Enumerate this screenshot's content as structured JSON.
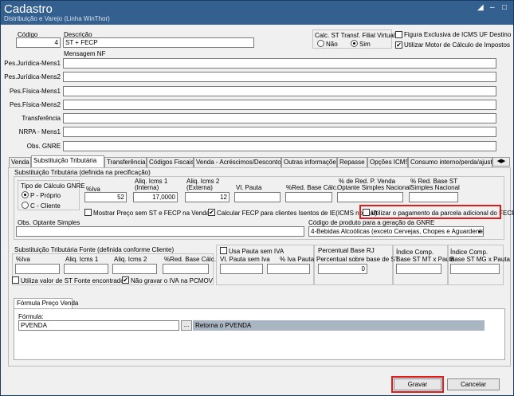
{
  "window": {
    "title": "Cadastro",
    "subtitle": "Distribuição e Varejo (Linha WinThor)"
  },
  "header": {
    "codigo_label": "Código",
    "codigo_value": "4",
    "descricao_label": "Descrição",
    "descricao_value": "ST + FECP",
    "calc_st_label": "Calc. ST Transf. Filial Virtual",
    "nao_label": "Não",
    "sim_label": "Sim",
    "figura_exclusiva_label": "Figura Exclusiva de ICMS UF Destino",
    "utilizar_motor_label": "Utilizar Motor de Cálculo de Impostos",
    "mensagem_nf_label": "Mensagem NF"
  },
  "messages": [
    {
      "label": "Pes.Jurídica-Mens1",
      "value": ""
    },
    {
      "label": "Pes.Jurídica-Mens2",
      "value": ""
    },
    {
      "label": "Pes.Física-Mens1",
      "value": ""
    },
    {
      "label": "Pes.Física-Mens2",
      "value": ""
    },
    {
      "label": "Transferência",
      "value": ""
    },
    {
      "label": "NRPA - Mens1",
      "value": ""
    },
    {
      "label": "Obs. GNRE",
      "value": ""
    }
  ],
  "tabs": [
    {
      "label": "Venda"
    },
    {
      "label": "Substituição Tributária"
    },
    {
      "label": "Transferência"
    },
    {
      "label": "Códigos Fiscais"
    },
    {
      "label": "Venda - Acréscimos/Descontos"
    },
    {
      "label": "Outras informações"
    },
    {
      "label": "Repasse"
    },
    {
      "label": "Opções ICMS"
    },
    {
      "label": "Consumo interno/perda/ajuste"
    }
  ],
  "st": {
    "group_title": "Substituição Tributária (definida na precificação)",
    "tipo_calculo_label": "Tipo de Cálculo GNRE",
    "p_proprio": "P - Próprio",
    "c_cliente": "C - Cliente",
    "iva_label": "%Iva",
    "iva_value": "52",
    "aliq1_label1": "Aliq. Icms 1",
    "aliq1_label2": "(Interna)",
    "aliq1_value": "17,0000",
    "aliq2_label1": "Aliq. Icms 2",
    "aliq2_label2": "(Externa)",
    "aliq2_value": "12",
    "vl_pauta_label": "Vl. Pauta",
    "vl_pauta_value": "",
    "red_base_label": "%Red. Base Cálc.",
    "red_base_value": "",
    "red_venda_label1": "% de Red. P. Venda",
    "red_venda_label2": "Optante Simples Nacional",
    "red_venda_value": "",
    "red_st_label1": "% Red. Base ST",
    "red_st_label2": "Simples Nacional",
    "red_st_value": "",
    "mostrar_preco_label": "Mostrar Preço sem ST e FECP na Venda",
    "calcular_fecp_label": "Calcular FECP para clientes Isentos de IE(ICMS normal)",
    "utilizar_parcela_label": "Utilizar o pagamento da parcela adicional do FECP",
    "obs_optante_label": "Obs. Optante Simples",
    "obs_optante_value": "",
    "codigo_produto_label": "Código de produto para a geração da GNRE",
    "codigo_produto_value": "4-Bebidas Alcoólicas (exceto Cervejas, Chopes e Aguardente)"
  },
  "fonte": {
    "group_title": "Substituição Tributária Fonte (definida conforme Cliente)",
    "iva_label": "%Iva",
    "aliq1_label": "Aliq. Icms 1",
    "aliq2_label": "Aliq. Icms 2",
    "red_base_label": "%Red. Base Cálc.",
    "utiliza_valor_label": "Utiliza valor de ST Fonte encontrado",
    "nao_gravar_label": "Não gravar o IVA na PCMOV",
    "usa_pauta_label": "Usa Pauta sem IVA",
    "vl_pauta_sem_iva_label": "Vl. Pauta sem Iva",
    "iva_pauta_label": "% Iva Pauta",
    "perc_base_rj_label1": "Percentual Base RJ",
    "perc_base_rj_label2": "Percentual sobre base de ST",
    "perc_base_rj_value": "0",
    "indice_mt_label1": "Índice Comp.",
    "indice_mt_label2": "Base ST MT x Pauta",
    "indice_mg_label1": "Índice Comp.",
    "indice_mg_label2": "Base ST MG x Pauta"
  },
  "formula": {
    "tab_label": "Fórmula Preço Venda",
    "formula_label": "Fórmula:",
    "formula_value": "PVENDA",
    "ellipsis": "...",
    "retorna_text": "Retorna o PVENDA"
  },
  "buttons": {
    "gravar": "Gravar",
    "cancelar": "Cancelar"
  },
  "colors": {
    "titlebar": "#34608f",
    "highlight": "#e01b1b"
  }
}
